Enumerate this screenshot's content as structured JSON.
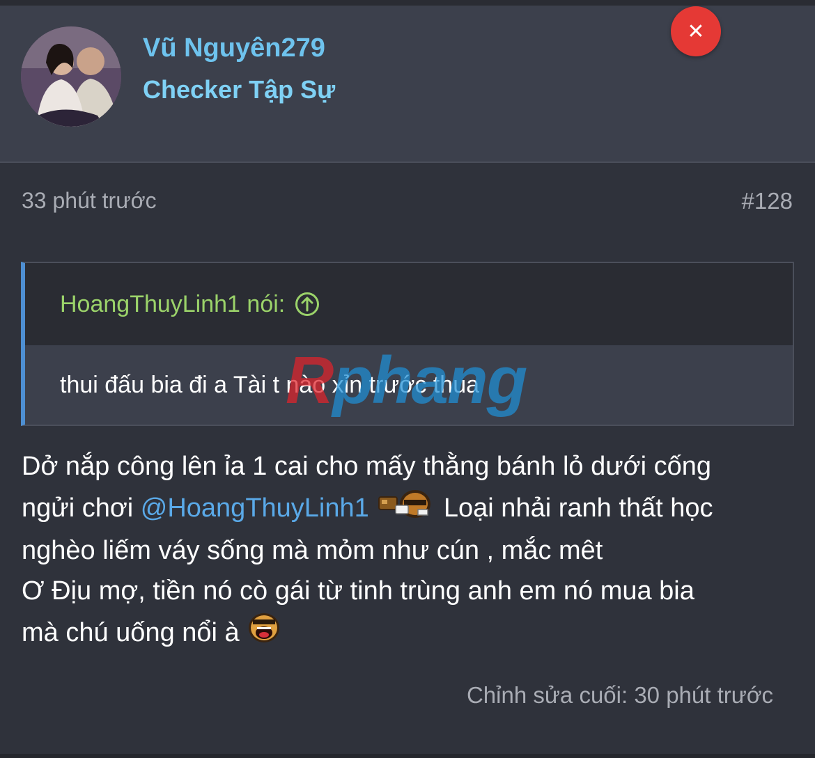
{
  "user": {
    "name": "Vũ Nguyên279",
    "title": "Checker Tập Sự"
  },
  "close_icon": "✕",
  "post": {
    "time": "33 phút trước",
    "number": "#128"
  },
  "quote": {
    "author_line": "HoangThuyLinh1 nói:",
    "text": "thui đấu bia đi a Tài t nào xỉn trước thua"
  },
  "watermark": {
    "first": "R",
    "rest": "phang"
  },
  "message": {
    "line1": "Dở nắp công lên ỉa 1 cai cho mấy thằng bánh lỏ dưới cống",
    "line2_pre": "ngửi chơi ",
    "mention": "@HoangThuyLinh1",
    "line2_post": " Loại nhải ranh thất học",
    "line3": "nghèo liếm váy sống mà mỏm như cún , mắc mêt",
    "line4": "Ơ Địu mợ, tiền nó cò gái từ tinh trùng anh em nó mua bia",
    "line5": "mà chú uống nổi à "
  },
  "edit_note": "Chỉnh sửa cuối: 30 phút trước",
  "colors": {
    "username": "#6ec3ee",
    "quote_author": "#9bd36a",
    "mention": "#5aa9e8",
    "close_button": "#e53935"
  }
}
